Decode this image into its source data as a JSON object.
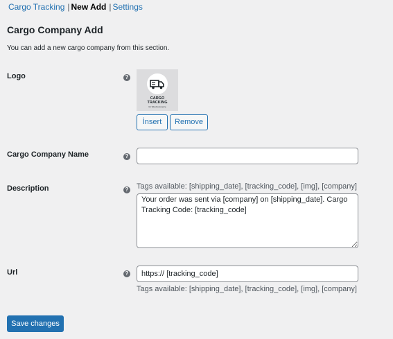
{
  "subnav": {
    "items": [
      {
        "label": "Cargo Tracking"
      },
      {
        "label": "New Add"
      },
      {
        "label": "Settings"
      }
    ],
    "separator": "|"
  },
  "page": {
    "title": "Cargo Company Add",
    "intro": "You can add a new cargo company from this section."
  },
  "help_glyph": "?",
  "form": {
    "logo": {
      "label": "Logo",
      "image_line1": "CARGO",
      "image_line2": "TRACKING",
      "image_line3": "for WooCommerce",
      "insert_label": "İnsert",
      "remove_label": "Remove"
    },
    "name": {
      "label": "Cargo Company Name",
      "value": ""
    },
    "description": {
      "label": "Description",
      "tags_hint": "Tags available: [shipping_date], [tracking_code], [img], [company]",
      "value": "Your order was sent via [company] on [shipping_date]. Cargo Tracking Code: [tracking_code]"
    },
    "url": {
      "label": "Url",
      "value": "https:// [tracking_code]",
      "tags_hint": "Tags available: [shipping_date], [tracking_code], [img], [company]"
    }
  },
  "submit_label": "Save changes",
  "colors": {
    "background": "#f0f0f1",
    "accent": "#2271b1",
    "text": "#1d2327",
    "muted": "#50575e"
  },
  "icons": {
    "help": "help-icon",
    "logo": "truck-icon"
  }
}
